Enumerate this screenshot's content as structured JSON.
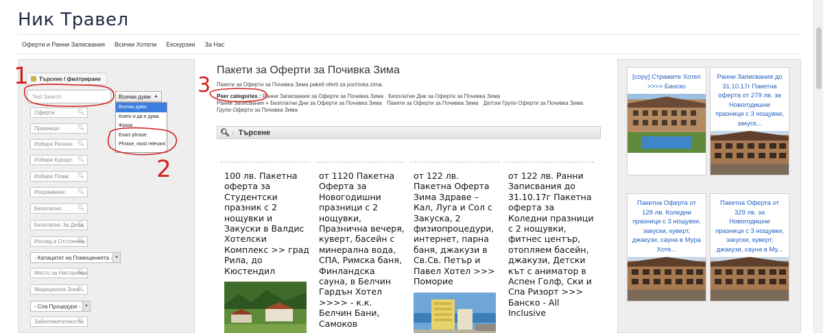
{
  "site": {
    "title": "Ник Травел"
  },
  "nav": {
    "items": [
      "Оферти и Ранни Записвания",
      "Всички Хотели",
      "Екскурзии",
      "За Нас"
    ]
  },
  "left_filters": {
    "tab_label": "Търсене / филтриране",
    "text_search_placeholder": "Text Search",
    "match_mode": {
      "selected": "Всички думи",
      "options": [
        "Всички думи",
        "Която и да е дума",
        "Фраза",
        "Exact phrase",
        "Phrase, most relevant"
      ]
    },
    "search_boxes": [
      "Оферти",
      "Празници",
      "Избери Регион:",
      "Избери Курорт:",
      "Избери Плаж:",
      "Изхранване:",
      "Безплатно:",
      "Безплатно За Деца:",
      "Изглед в Отстояние:"
    ],
    "capacity_select": "- Капацитет на Помещенията -",
    "search_boxes_2": [
      "Място за Настаняване:",
      "Медицинска Зона:"
    ],
    "spa_select": "- Спа Процедури -",
    "search_boxes_3": [
      "Забележителности:"
    ]
  },
  "main": {
    "title": "Пакети за Оферти за Почивка Зима",
    "description": "Пакети за Оферти за Почивка Зима paketi oferti za pochivka zima.",
    "peer_label": "Peer categories :",
    "peer_categories": [
      "Ранни Записвания за Оферти за Почивка Зима",
      "Безплатни Дни за Оферти за Почивка Зима",
      "Ранни Записвания + Безплатни Дни за Оферти за Почивка Зима",
      "Пакети за Оферти за Почивка Зима",
      "Детски Групи Оферти за Почивка Зима",
      "Групи Оферти за Почивка Зима"
    ],
    "search_label": "Търсене",
    "offers": [
      {
        "text": "100 лв. Пакетна оферта за Студентски празник с 2 нощувки и Закуски в Валдис Хотелски Комплекс >> град Рила, до Кюстендил"
      },
      {
        "text": "от 1120 Пакетна Оферта за Новогодишни празници с 2 нощувки, Празнична вечеря, куверт, басейн с минерална вода, СПА, Римска баня, Финландска сауна, в Белчин Гардън Хотел >>>> - к.к. Белчин Бани, Самоков"
      },
      {
        "text": "от 122 лв. Пакетна Оферта Зима Здраве – Кал, Луга и Сол с Закуска, 2 физиопроцедури, интернет, парна баня, джакузи в Св.Св. Петър и Павел Хотел >>> Поморие"
      },
      {
        "text": "от 122 лв. Ранни Записвания до 31.10.17г Пакетна оферта за Коледни празници с 2 нощувки, фитнес център, отопляем басейн, джакузи, Детски кът с аниматор в Аспен Голф, Ски и Спа Ризорт >>> Банско - All Inclusive"
      }
    ]
  },
  "right_offers": [
    {
      "text": "[copy] Стражите Хотел >>>> Банско"
    },
    {
      "text": "Ранни Записвания до 31.10.17г Пакетна оферта от 279 лв. за Новогодишни празници с 3 нощувки, закуск..."
    },
    {
      "text": "Пакетна Оферта от 128 лв. Коледни празници с 3 нощувки, закуски, куверт, джакузи, сауна в Мура Хоте..."
    },
    {
      "text": "Пакетна Оферта от 329 лв. за Новогодишни празници с 3 нощувки, закуски, куверт, джакузи, сауна в Му..."
    }
  ],
  "annotations": {
    "marker_1": "1",
    "marker_2": "2",
    "marker_3": "3",
    "color": "#d42020"
  },
  "colors": {
    "link": "#2060c0",
    "title": "#1f2a44",
    "selected_option": "#3b7de0"
  }
}
